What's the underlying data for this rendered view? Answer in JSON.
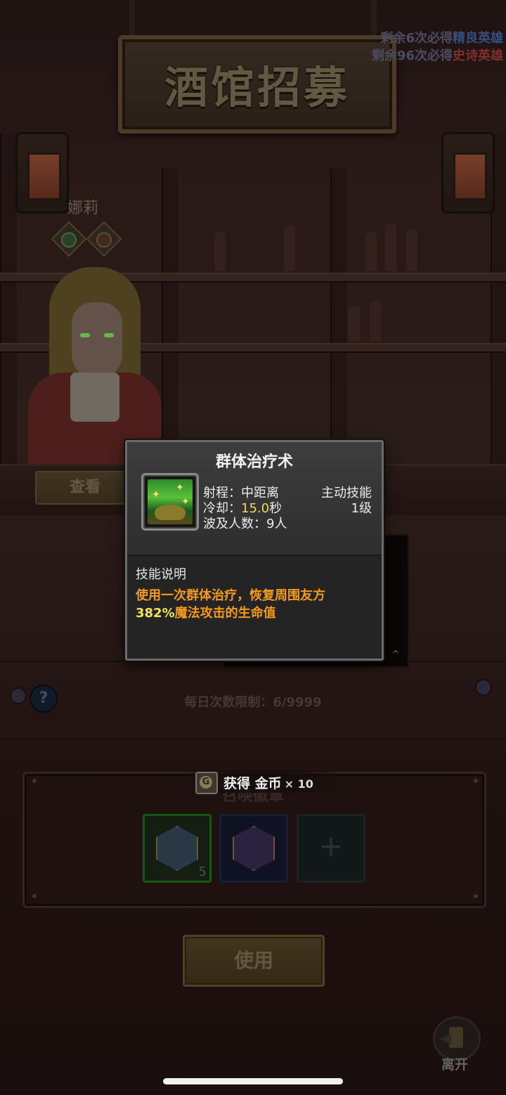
{
  "header": {
    "title": "酒馆招募",
    "hint_elite_prefix": "剩余6次必得",
    "hint_elite_tier": "精良英雄",
    "hint_epic_prefix": "剩余96次必得",
    "hint_epic_tier": "史诗英雄"
  },
  "hero": {
    "name": "娜莉",
    "view_button": "查看"
  },
  "daily_limit": "每日次数限制：6/9999",
  "help_icon": "?",
  "panel": {
    "title": "召唤徽章",
    "slots": [
      {
        "icon": "hero-medal-icon",
        "count": "5"
      },
      {
        "icon": "epic-medal-icon",
        "count": ""
      },
      {
        "icon": "plus-icon",
        "count": ""
      }
    ],
    "use_button": "使用"
  },
  "toast": {
    "prefix": "获得",
    "item": "金币",
    "multiplier": "× 10"
  },
  "leave_label": "离开",
  "skill_popup": {
    "title": "群体治疗术",
    "range_label": "射程：",
    "range_value": "中距离",
    "type": "主动技能",
    "cooldown_label": "冷却：",
    "cooldown_value": "15.0",
    "cooldown_unit": "秒",
    "level": "1级",
    "targets": "波及人数：9人",
    "section_title": "技能说明",
    "desc_line1": "使用一次群体治疗，恢复周围友方",
    "desc_pct": "382%",
    "desc_line2_rest": "魔法攻击的生命值"
  },
  "colors": {
    "desc_orange": "#f39a1f",
    "highlight_yellow": "#f0d85a",
    "elite_blue": "#4d6bb2",
    "epic_red": "#b04040"
  }
}
